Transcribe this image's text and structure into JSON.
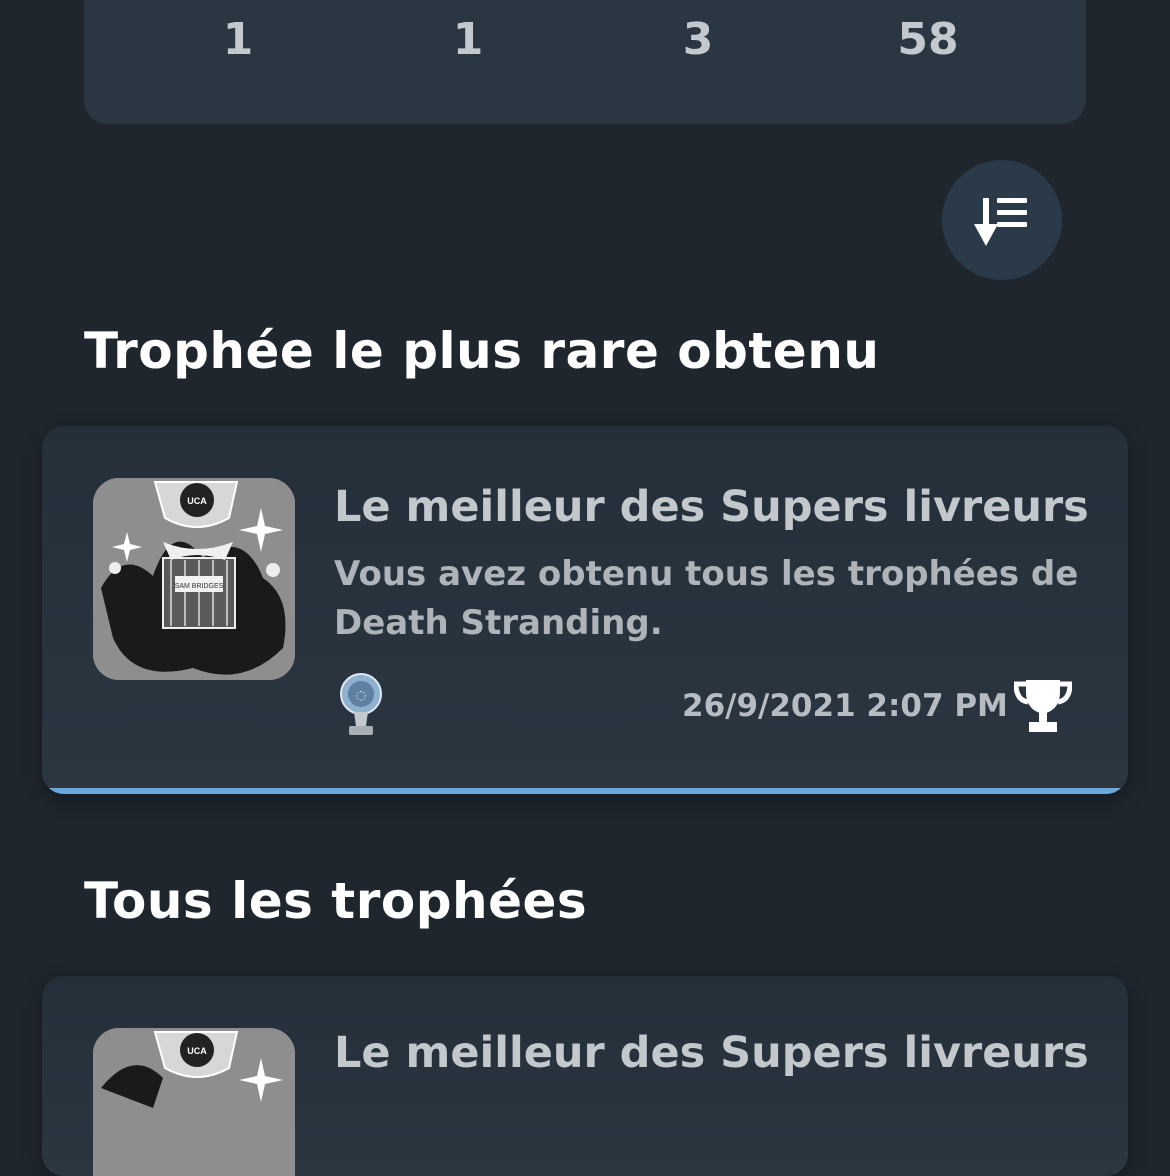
{
  "summary": {
    "counts": [
      {
        "grade": "platinum",
        "value": "1"
      },
      {
        "grade": "gold",
        "value": "1"
      },
      {
        "grade": "silver",
        "value": "3"
      },
      {
        "grade": "bronze",
        "value": "58"
      }
    ]
  },
  "sort_button": {
    "icon": "sort-descending-icon"
  },
  "rarest": {
    "title": "Trophée le plus rare obtenu",
    "trophy": {
      "name": "Le meilleur des Supers livreurs",
      "description": "Vous avez obtenu tous les trophées de Death Stranding.",
      "date": "26/9/2021  2:07 PM",
      "grade_icon": "platinum-trophy-icon",
      "status_icon": "trophy-cup-icon",
      "badge_text": "UCA",
      "plate_text": "SAM BRIDGES"
    }
  },
  "all": {
    "title": "Tous les trophées",
    "first_trophy": {
      "name": "Le meilleur des Supers livreurs",
      "badge_text": "UCA"
    }
  },
  "colors": {
    "background": "#1f262d",
    "card": "#2a3642",
    "accent_bar": "#6aa8e0"
  }
}
